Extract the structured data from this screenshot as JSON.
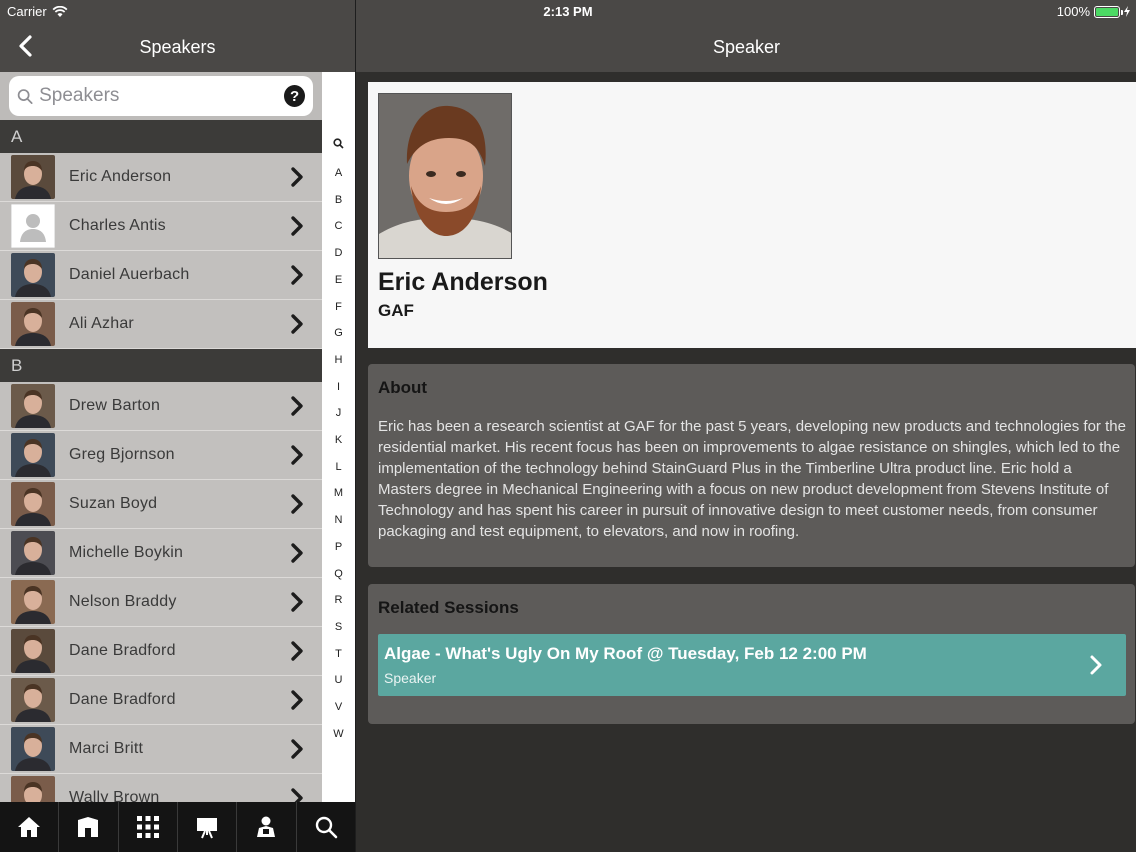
{
  "status_bar": {
    "carrier": "Carrier",
    "time": "2:13 PM",
    "battery": "100%"
  },
  "left_panel": {
    "title": "Speakers",
    "search": {
      "placeholder": "Speakers",
      "value": ""
    },
    "sections": [
      {
        "letter": "A",
        "items": [
          {
            "name": "Eric Anderson",
            "avatar": "photo"
          },
          {
            "name": "Charles Antis",
            "avatar": "placeholder"
          },
          {
            "name": "Daniel Auerbach",
            "avatar": "photo"
          },
          {
            "name": "Ali Azhar",
            "avatar": "photo"
          }
        ]
      },
      {
        "letter": "B",
        "items": [
          {
            "name": "Drew Barton",
            "avatar": "photo"
          },
          {
            "name": "Greg Bjornson",
            "avatar": "photo"
          },
          {
            "name": "Suzan Boyd",
            "avatar": "photo"
          },
          {
            "name": "Michelle Boykin",
            "avatar": "photo"
          },
          {
            "name": "Nelson Braddy",
            "avatar": "photo"
          },
          {
            "name": "Dane Bradford",
            "avatar": "photo"
          },
          {
            "name": "Dane Bradford",
            "avatar": "photo"
          },
          {
            "name": "Marci Britt",
            "avatar": "photo"
          },
          {
            "name": "Wally Brown",
            "avatar": "photo"
          }
        ]
      }
    ],
    "index_letters": [
      "A",
      "B",
      "C",
      "D",
      "E",
      "F",
      "G",
      "H",
      "I",
      "J",
      "K",
      "L",
      "M",
      "N",
      "P",
      "Q",
      "R",
      "S",
      "T",
      "U",
      "V",
      "W"
    ],
    "tabs": [
      "home-icon",
      "building-icon",
      "grid-icon",
      "presentation-icon",
      "speaker-icon",
      "search-icon"
    ]
  },
  "right_panel": {
    "title": "Speaker",
    "speaker": {
      "name": "Eric Anderson",
      "company": "GAF"
    },
    "about": {
      "heading": "About",
      "text": "Eric has been a research scientist at GAF for the past 5 years, developing new products and technologies for the residential market. His recent focus has been on improvements to algae resistance on shingles, which led to the implementation of the technology behind StainGuard Plus in the Timberline Ultra product line. Eric hold a Masters degree in Mechanical Engineering with a focus on new product development from Stevens Institute of Technology and has spent his career in pursuit of innovative design to meet customer needs, from consumer packaging and test equipment, to elevators, and now in roofing."
    },
    "related_sessions": {
      "heading": "Related Sessions",
      "items": [
        {
          "title": "Algae - What's Ugly On My Roof @ Tuesday, Feb 12 2:00 PM",
          "role": "Speaker"
        }
      ]
    }
  },
  "colors": {
    "header": "#4a4846",
    "accent": "#5ba7a0",
    "list_bg": "#c2c0be",
    "section_header": "#3c3b39"
  }
}
